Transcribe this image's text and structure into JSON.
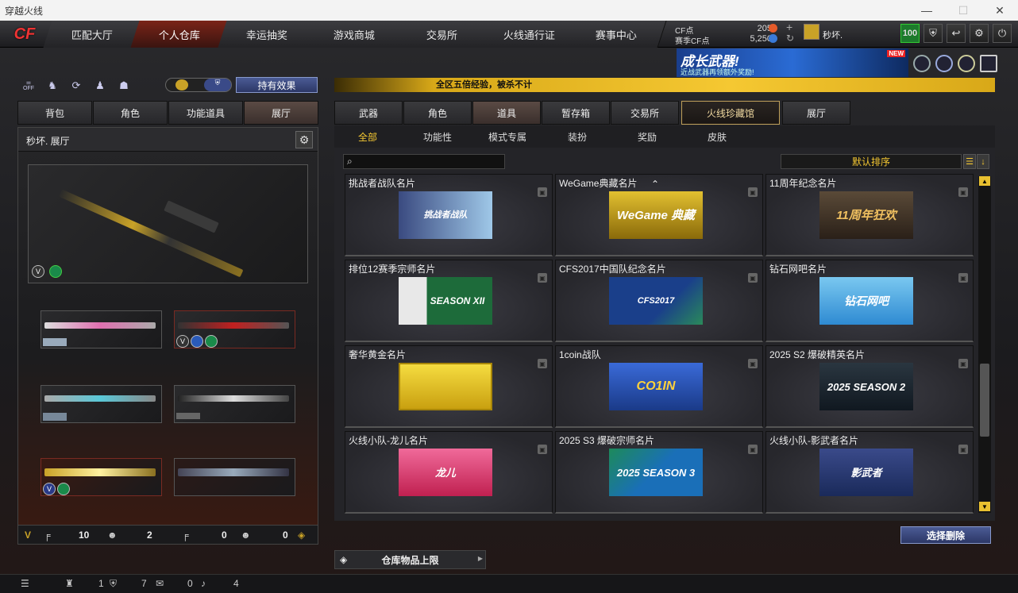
{
  "window": {
    "title": "穿越火线",
    "minimize": "—",
    "maximize": "☐",
    "close": "✕"
  },
  "logo": {
    "text": "CF"
  },
  "nav": {
    "tabs": [
      {
        "label": "匹配大厅",
        "active": false
      },
      {
        "label": "个人仓库",
        "active": true
      },
      {
        "label": "幸运抽奖",
        "active": false
      },
      {
        "label": "游戏商城",
        "active": false
      },
      {
        "label": "交易所",
        "active": false
      },
      {
        "label": "火线通行证",
        "active": false
      },
      {
        "label": "赛事中心",
        "active": false
      }
    ]
  },
  "currency": {
    "cf_label": "CF点",
    "cf_value": "205",
    "season_label": "赛季CF点",
    "season_value": "5,250",
    "plus": "+",
    "refresh": "↻"
  },
  "user": {
    "name": "秒坏.",
    "level": "100"
  },
  "banner": {
    "title": "成长武器!",
    "subtitle": "近战武器再领额外奖励!",
    "badge": "NEW"
  },
  "left_toolbar": {
    "off_label": "OFF",
    "effect_button": "持有效果"
  },
  "ticker": "全区五倍经验，被杀不计",
  "left_tabs": [
    {
      "label": "背包",
      "active": false
    },
    {
      "label": "角色",
      "active": false
    },
    {
      "label": "功能道具",
      "active": false
    },
    {
      "label": "展厅",
      "active": true
    }
  ],
  "left_panel": {
    "title": "秒坏. 展厅"
  },
  "left_footer": {
    "primary_count": "10",
    "char_count": "2",
    "secondary_count": "0",
    "char2_count": "0",
    "v_label": "V"
  },
  "right_tabs": [
    {
      "label": "武器",
      "active": false
    },
    {
      "label": "角色",
      "active": false
    },
    {
      "label": "道具",
      "active": true
    },
    {
      "label": "暂存箱",
      "active": false
    },
    {
      "label": "交易所",
      "active": false
    },
    {
      "label": "火线珍藏馆",
      "active": false
    },
    {
      "label": "展厅",
      "active": false
    }
  ],
  "sub_tabs": [
    {
      "label": "全部",
      "active": true
    },
    {
      "label": "功能性",
      "active": false
    },
    {
      "label": "模式专属",
      "active": false
    },
    {
      "label": "装扮",
      "active": false
    },
    {
      "label": "奖励",
      "active": false
    },
    {
      "label": "皮肤",
      "active": false
    }
  ],
  "search": {
    "placeholder": ""
  },
  "sort": {
    "label": "默认排序"
  },
  "cards": [
    {
      "name": "挑战者战队名片",
      "art": "挑战者战队",
      "bg": "#5a7fb0",
      "fg": "#fff"
    },
    {
      "name": "WeGame典藏名片",
      "art": "WeGame 典藏",
      "bg": "#c4a012",
      "fg": "#fff"
    },
    {
      "name": "11周年纪念名片",
      "art": "11周年狂欢",
      "bg": "#3a2e22",
      "fg": "#f0c060"
    },
    {
      "name": "排位12赛季宗师名片",
      "art": "SEASON XII",
      "bg": "#1d6b3a",
      "fg": "#fff"
    },
    {
      "name": "CFS2017中国队纪念名片",
      "art": "CFS2017",
      "bg": "#1a3f8a",
      "fg": "#fff"
    },
    {
      "name": "钻石网吧名片",
      "art": "钻石网吧",
      "bg": "#2e8ad2",
      "fg": "#fff"
    },
    {
      "name": "奢华黄金名片",
      "art": "",
      "bg": "#e6c21a",
      "fg": "#fff"
    },
    {
      "name": "1coin战队",
      "art": "CO1IN",
      "bg": "#2d56b8",
      "fg": "#ffd23a"
    },
    {
      "name": "2025 S2 爆破精英名片",
      "art": "2025 SEASON 2",
      "bg": "#1a2630",
      "fg": "#fff"
    },
    {
      "name": "火线小队-龙儿名片",
      "art": "龙儿",
      "bg": "#e84a7a",
      "fg": "#fff"
    },
    {
      "name": "2025 S3 爆破宗师名片",
      "art": "2025 SEASON 3",
      "bg": "#1a6fb8",
      "fg": "#fff"
    },
    {
      "name": "火线小队-影武者名片",
      "art": "影武者",
      "bg": "#2a3a6a",
      "fg": "#fff"
    }
  ],
  "delete_button": "选择删除",
  "capacity": {
    "label": "仓库物品上限"
  },
  "status_bar": {
    "a": "1",
    "b": "7",
    "c": "0",
    "d": "4"
  },
  "colors": {
    "accent_gold": "#f5c832",
    "active_tab": "#7a2418",
    "button_blue": "#3c4a80"
  }
}
